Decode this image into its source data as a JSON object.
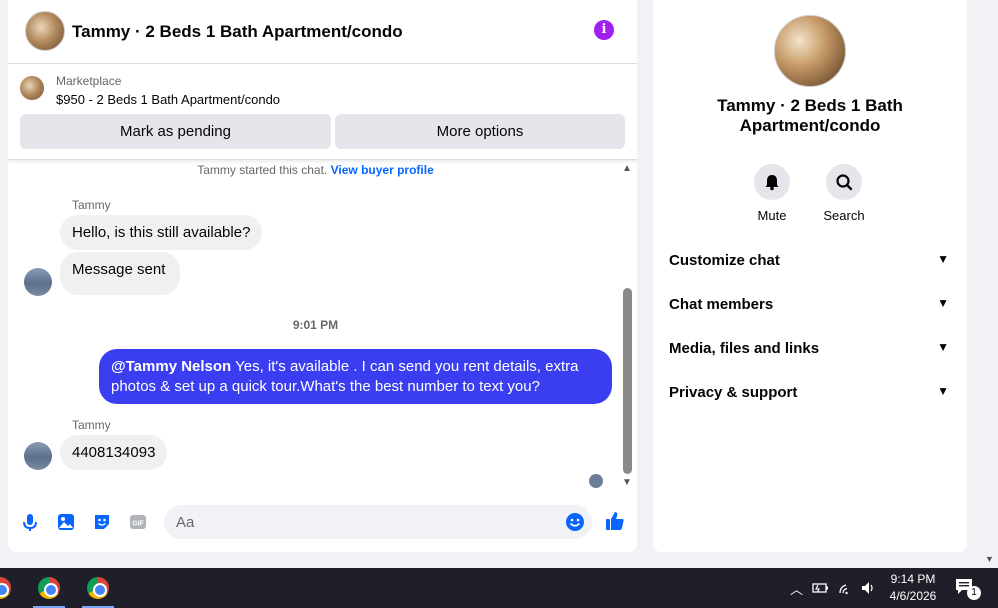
{
  "chat": {
    "title": "Tammy · 2 Beds 1 Bath Apartment/condo",
    "info_icon": "i",
    "marketplace_label": "Marketplace",
    "listing": "$950 - 2 Beds 1 Bath Apartment/condo",
    "mark_pending": "Mark as pending",
    "more_options": "More options",
    "started_text": "Tammy started this chat.",
    "view_buyer_profile": "View buyer profile",
    "messages": [
      {
        "sender": "Tammy",
        "text": "Hello, is this still available?"
      },
      {
        "text": "Message sent"
      }
    ],
    "timestamp": "9:01 PM",
    "outgoing_mention": "@Tammy Nelson",
    "outgoing_text": " Yes, it's available .  I can send you rent details, extra photos & set up a quick tour.What's the best number to text you?",
    "reply_sender": "Tammy",
    "reply_text": "4408134093",
    "composer_placeholder": "Aa"
  },
  "info": {
    "title": "Tammy · 2 Beds 1 Bath Apartment/condo",
    "mute_label": "Mute",
    "search_label": "Search",
    "sections": [
      "Customize chat",
      "Chat members",
      "Media, files and links",
      "Privacy & support"
    ]
  },
  "taskbar": {
    "time": "9:14 PM",
    "date": "4/6/2026",
    "notification_count": "1"
  },
  "colors": {
    "accent": "#0866ff",
    "outgoing_bubble": "#3a3df0",
    "info_icon": "#a020f0"
  }
}
